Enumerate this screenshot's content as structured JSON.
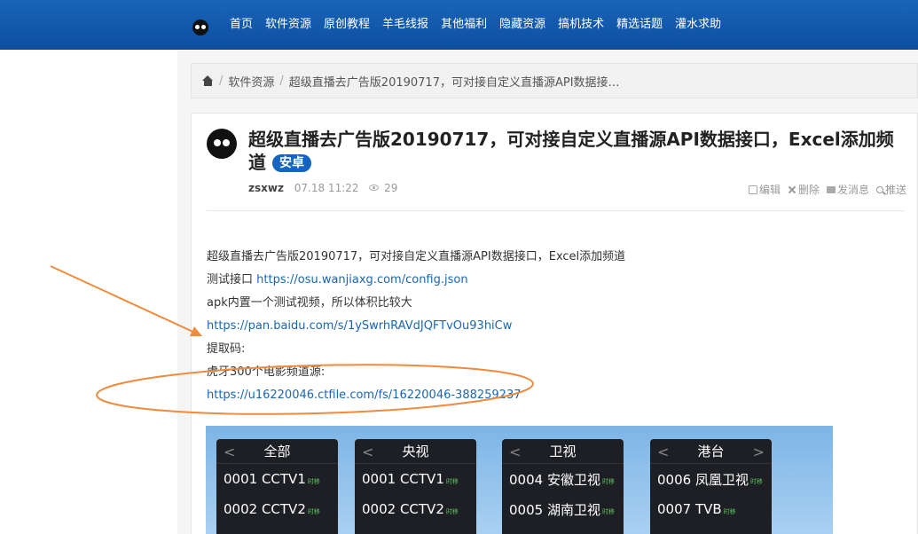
{
  "nav": {
    "items": [
      "首页",
      "软件资源",
      "原创教程",
      "羊毛线报",
      "其他福利",
      "隐藏资源",
      "搞机技术",
      "精选话题",
      "灌水求助"
    ]
  },
  "breadcrumb": {
    "items": [
      "软件资源",
      "超级直播去广告版20190717，可对接自定义直播源API数据接…"
    ]
  },
  "post": {
    "title": "超级直播去广告版20190717，可对接自定义直播源API数据接口，Excel添加频道",
    "tag": "安卓",
    "author": "zsxwz",
    "date": "07.18 11:22",
    "views": "29",
    "actions": [
      "编辑",
      "删除",
      "发消息",
      "推送"
    ]
  },
  "content": {
    "line1": "超级直播去广告版20190717，可对接自定义直播源API数据接口，Excel添加频道",
    "test_label": "测试接口 ",
    "test_link": "https://osu.wanjiaxg.com/config.json",
    "line3": "apk内置一个测试视频，所以体积比较大",
    "baidu_link": "https://pan.baidu.com/s/1ySwrhRAVdJQFTvOu93hiCw",
    "code_label": "提取码:",
    "huya_label": "虎牙300个电影频道源:",
    "ctfile_link": "https://u16220046.ctfile.com/fs/16220046-388259237"
  },
  "screenshot_panels": [
    {
      "header": "全部",
      "rows": [
        {
          "t": "0001 CCTV1",
          "b": "时移"
        },
        {
          "t": "0002 CCTV2",
          "b": "时移"
        }
      ]
    },
    {
      "header": "央视",
      "rows": [
        {
          "t": "0001 CCTV1",
          "b": "时移"
        },
        {
          "t": "0002 CCTV2",
          "b": "时移"
        }
      ]
    },
    {
      "header": "卫视",
      "rows": [
        {
          "t": "0004 安徽卫视",
          "b": "时移"
        },
        {
          "t": "0005 湖南卫视",
          "b": "时移"
        }
      ]
    },
    {
      "header": "港台",
      "rows": [
        {
          "t": "0006 凤凰卫视",
          "b": "时移"
        },
        {
          "t": "0007 TVB",
          "b": "时移"
        }
      ]
    }
  ],
  "colors": {
    "nav_bg": "#0d4fa0",
    "link": "#1a66b3",
    "tag_bg": "#1565c0",
    "annotation": "#f08a3c"
  }
}
